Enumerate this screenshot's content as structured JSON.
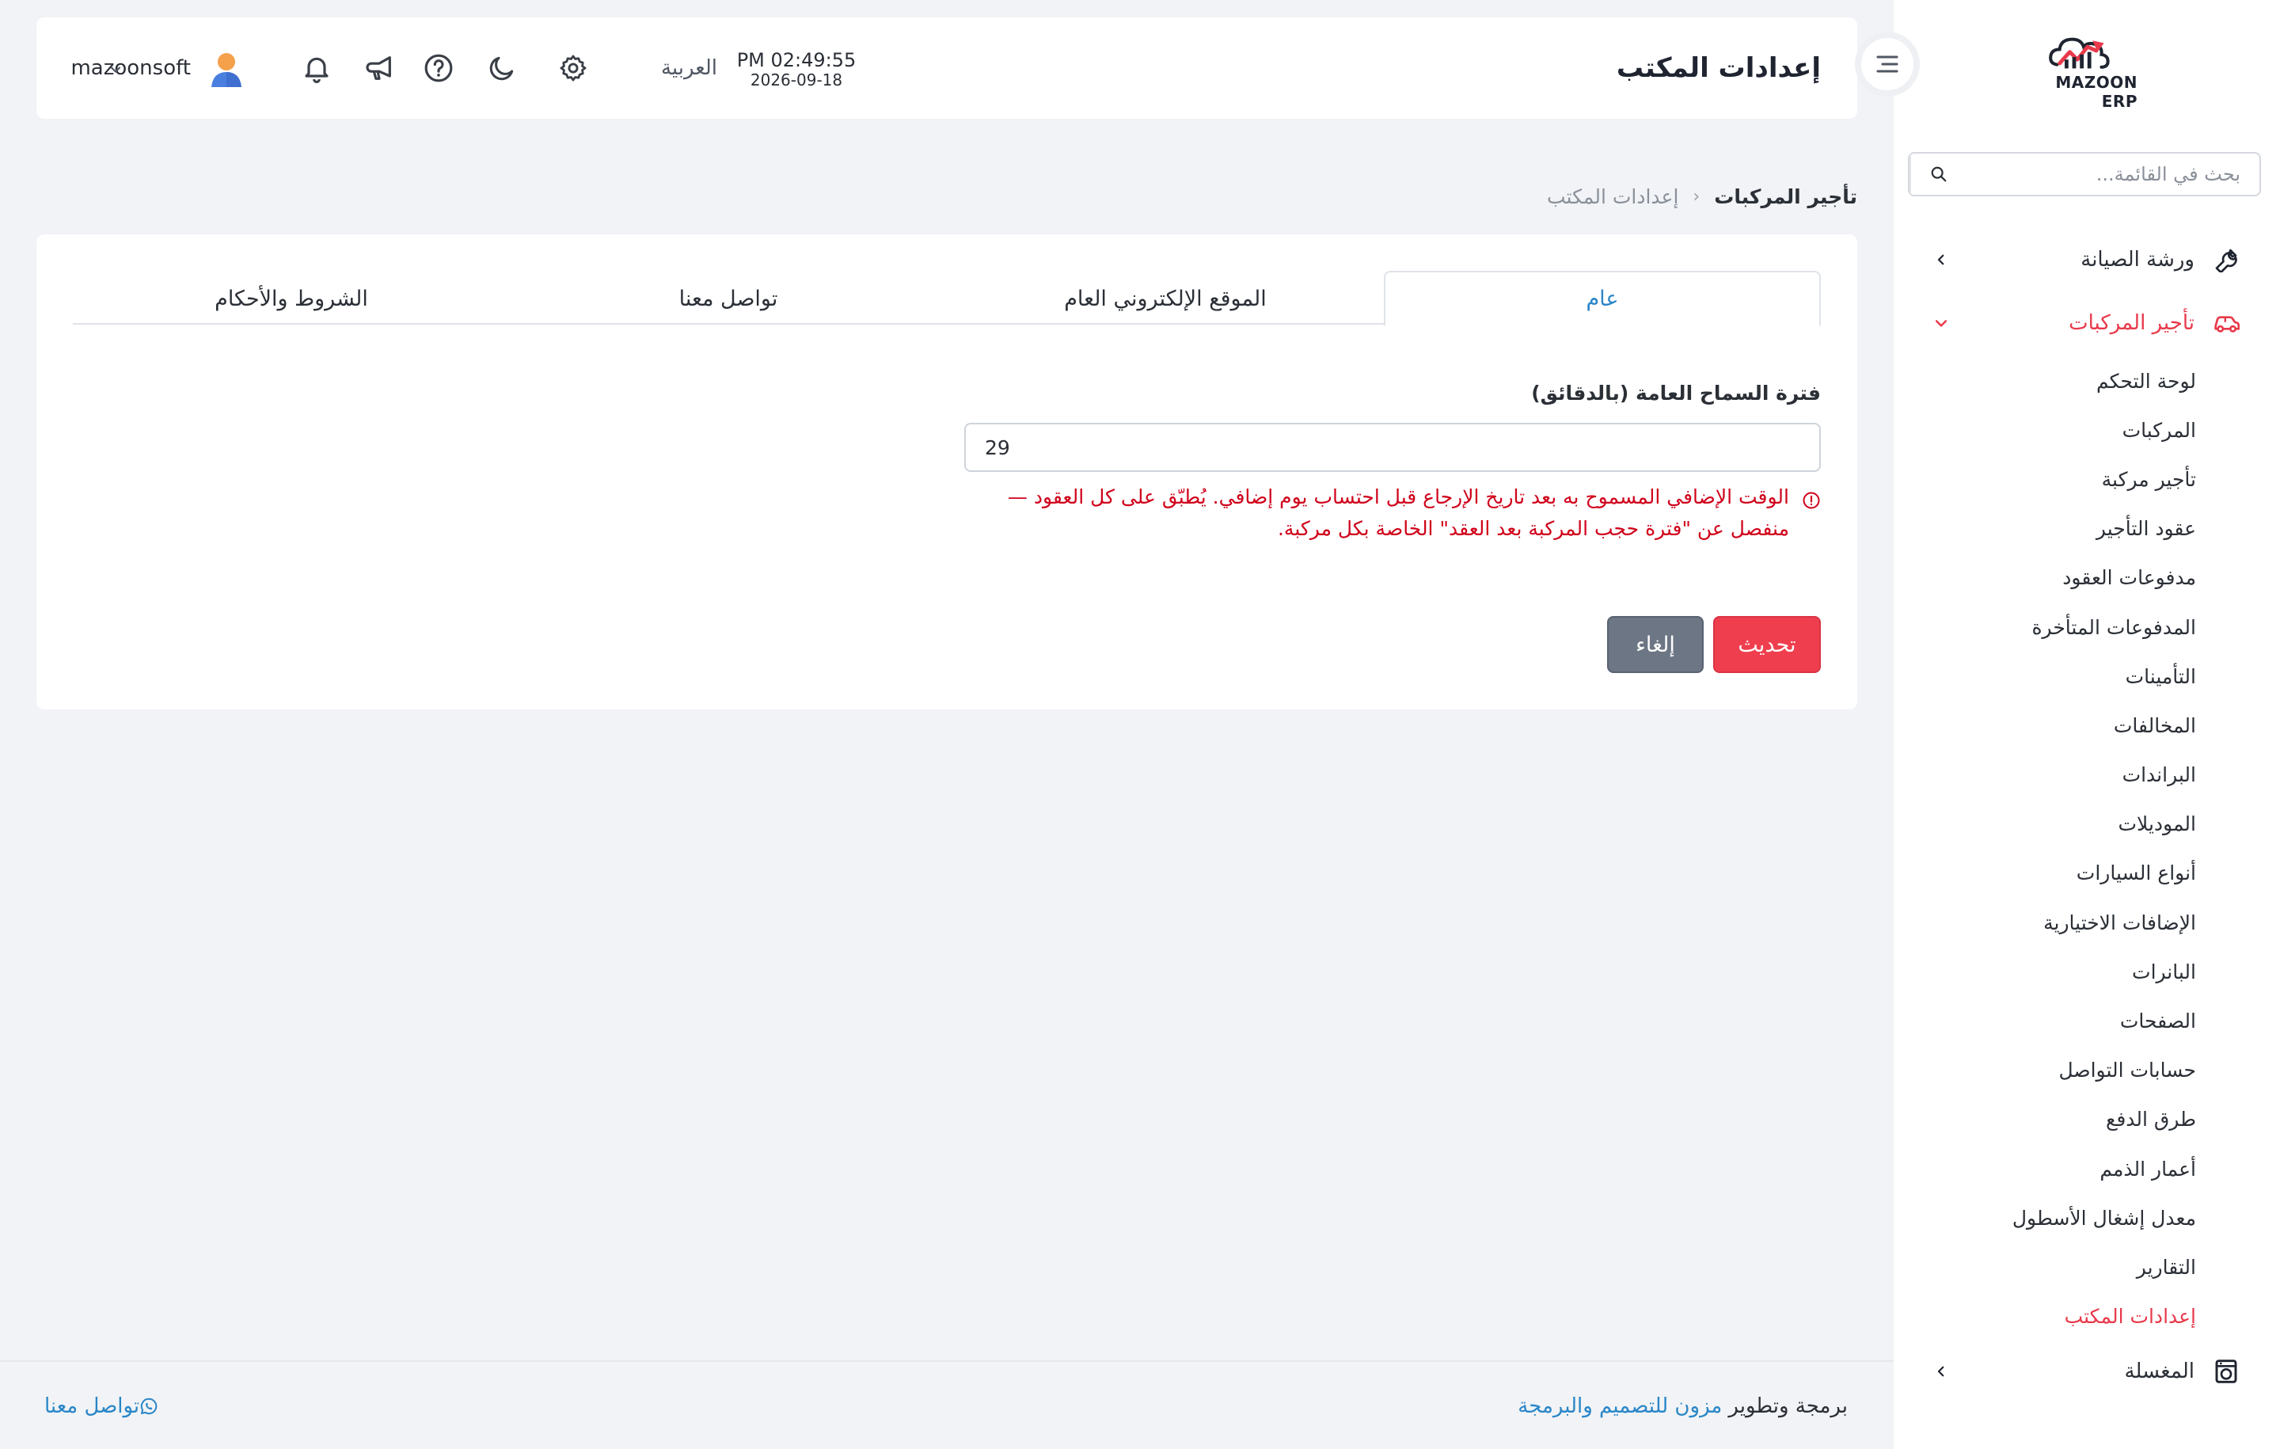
{
  "brand": {
    "name": "MAZOON ERP",
    "tagline": "ERP"
  },
  "sidebar": {
    "search_placeholder": "بحث في القائمة...",
    "groups": [
      {
        "label": "ورشة الصيانة",
        "icon": "wrench-icon",
        "expanded": false
      },
      {
        "label": "تأجير المركبات",
        "icon": "car-icon",
        "expanded": true
      },
      {
        "label": "المغسلة",
        "icon": "laundry-icon",
        "expanded": false
      }
    ],
    "subitems": [
      "لوحة التحكم",
      "المركبات",
      "تأجير مركبة",
      "عقود التأجير",
      "مدفوعات العقود",
      "المدفوعات المتأخرة",
      "التأمينات",
      "المخالفات",
      "البراندات",
      "الموديلات",
      "أنواع السيارات",
      "الإضافات الاختيارية",
      "البانرات",
      "الصفحات",
      "حسابات التواصل",
      "طرق الدفع",
      "أعمار الذمم",
      "معدل إشغال الأسطول",
      "التقارير",
      "إعدادات المكتب"
    ],
    "active_subitem": "إعدادات المكتب"
  },
  "header": {
    "title": "إعدادات المكتب",
    "time": "PM 02:49:55",
    "date": "2026-09-18",
    "language": "العربية",
    "username": "mazoonsoft"
  },
  "breadcrumb": {
    "parent": "تأجير المركبات",
    "current": "إعدادات المكتب"
  },
  "tabs": [
    {
      "label": "عام",
      "active": true
    },
    {
      "label": "الموقع الإلكتروني العام",
      "active": false
    },
    {
      "label": "تواصل معنا",
      "active": false
    },
    {
      "label": "الشروط والأحكام",
      "active": false
    }
  ],
  "form": {
    "grace_label": "فترة السماح العامة (بالدقائق)",
    "grace_value": "29",
    "grace_help": "الوقت الإضافي المسموح به بعد تاريخ الإرجاع قبل احتساب يوم إضافي. يُطبّق على كل العقود — منفصل عن \"فترة حجب المركبة بعد العقد\" الخاصة بكل مركبة.",
    "update_label": "تحديث",
    "cancel_label": "إلغاء"
  },
  "footer": {
    "credit_prefix": "برمجة وتطوير",
    "credit_link": "مزون للتصميم والبرمجة",
    "contact_label": "تواصل معنا"
  },
  "colors": {
    "accent_red": "#ef3f4e",
    "link_blue": "#2a86c7",
    "error_red": "#d0021b",
    "cancel_gray": "#6c7684"
  }
}
